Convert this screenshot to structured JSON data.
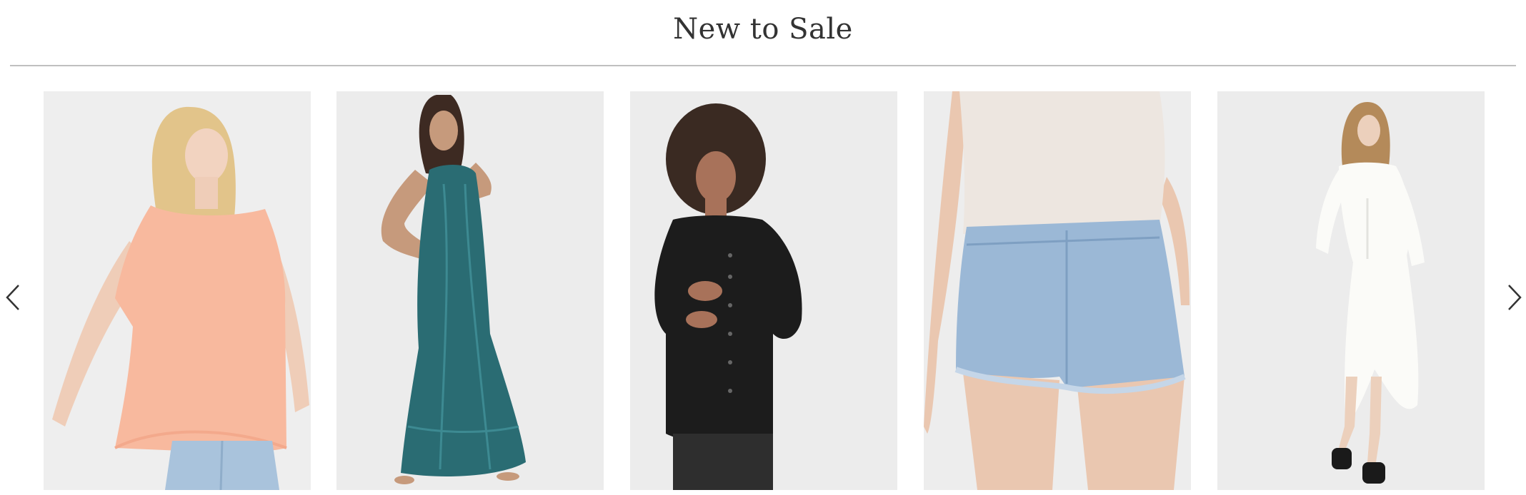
{
  "section": {
    "title": "New to Sale"
  },
  "navigation": {
    "prev_icon": "chevron-left-icon",
    "next_icon": "chevron-right-icon"
  },
  "products": [
    {
      "name": "peach-flutter-sleeve-tee-image",
      "palette": {
        "bg": "#eeeeee",
        "garment": "#f8b99e",
        "accent": "#a9c3dc"
      }
    },
    {
      "name": "teal-lace-maxi-dress-image",
      "palette": {
        "bg": "#ececec",
        "garment": "#2a6c73",
        "accent": "#3d2a22"
      }
    },
    {
      "name": "black-button-tunic-image",
      "palette": {
        "bg": "#ececec",
        "garment": "#1c1c1c",
        "accent": "#3a2a22"
      }
    },
    {
      "name": "denim-cutoff-shorts-image",
      "palette": {
        "bg": "#ededed",
        "garment": "#9bb8d6",
        "accent": "#ede6e0"
      }
    },
    {
      "name": "white-corset-dress-image",
      "palette": {
        "bg": "#ececec",
        "garment": "#fbfbf8",
        "accent": "#b48a5a"
      }
    }
  ]
}
